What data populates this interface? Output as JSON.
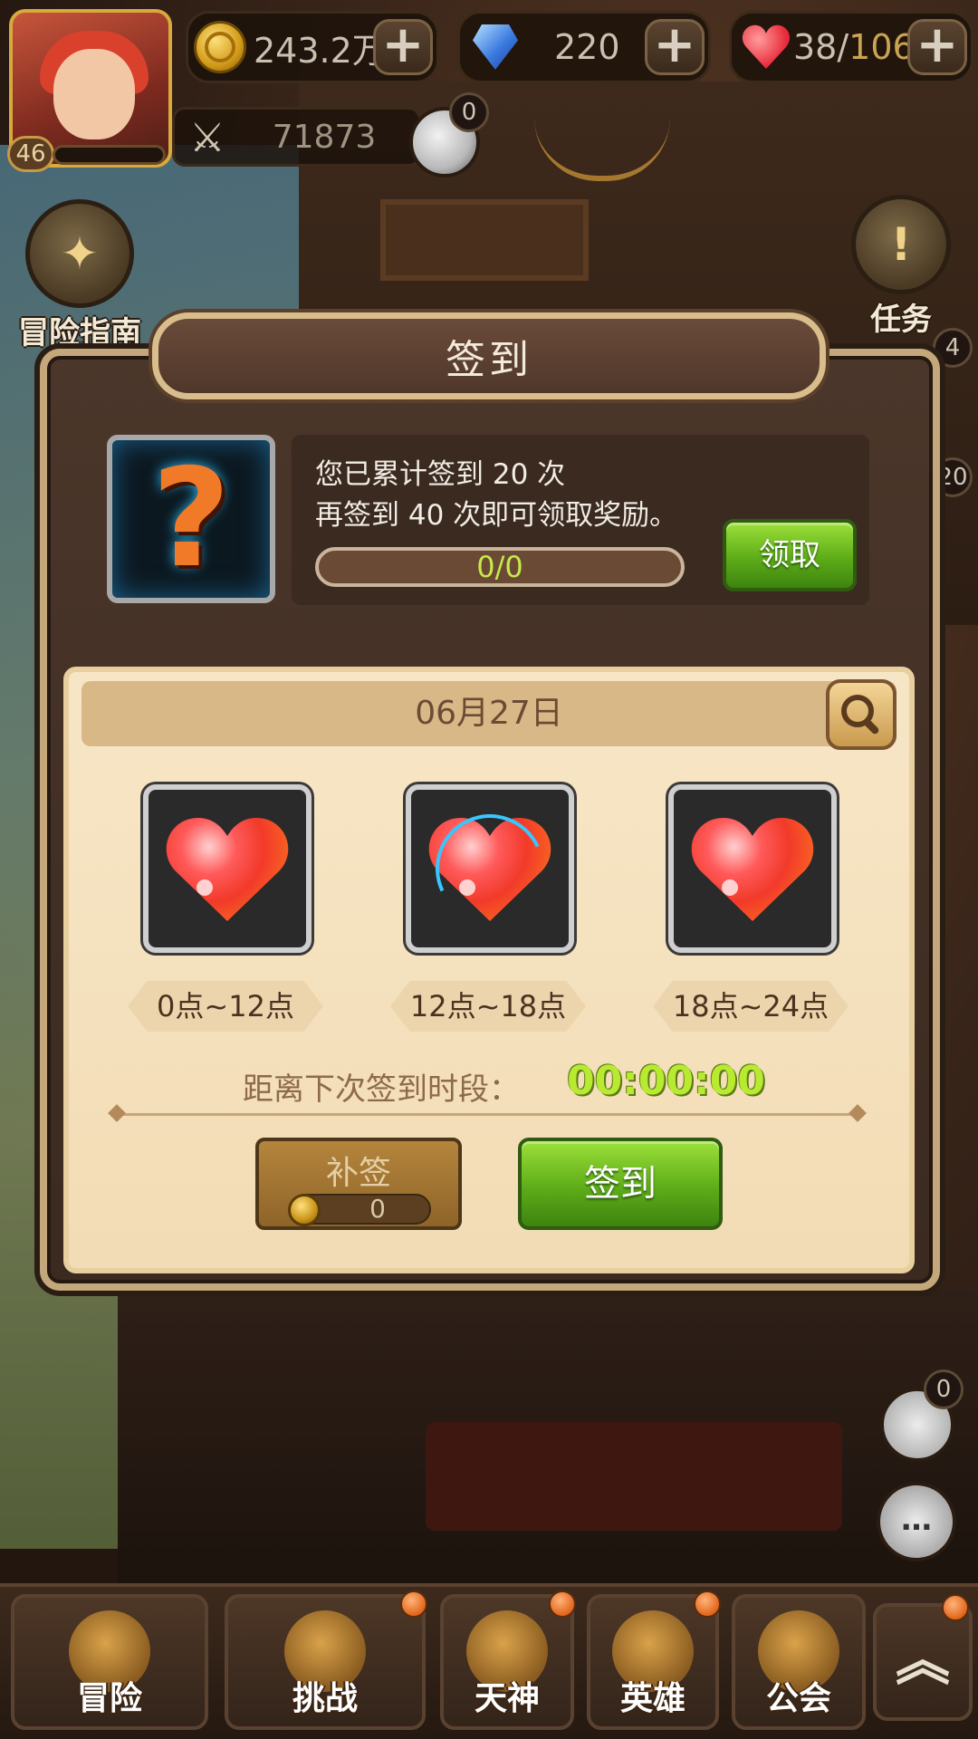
{
  "header": {
    "player_level": "46",
    "gold": "243.2万",
    "gems": "220",
    "stamina_current": "38",
    "stamina_separator": "/",
    "stamina_max": "106",
    "power": "71873",
    "chef_badge": "0"
  },
  "side": {
    "adventure_guide": "冒险指南",
    "tasks": "任务",
    "right_badge_1": "4",
    "right_badge_2": "20",
    "mail_badge": "0"
  },
  "dialog": {
    "title": "签到",
    "reward_line_1": "您已累计签到 20 次",
    "reward_line_2": "再签到 40 次即可领取奖励。",
    "progress_text": "0/0",
    "claim_label": "领取",
    "date": "06月27日",
    "slots": [
      {
        "label": "0点~12点",
        "active": false
      },
      {
        "label": "12点~18点",
        "active": true
      },
      {
        "label": "18点~24点",
        "active": false
      }
    ],
    "countdown_label": "距离下次签到时段：",
    "countdown_value": "00:00:00",
    "makeup_label": "补签",
    "makeup_cost": "0",
    "signin_label": "签到"
  },
  "nav": {
    "items": [
      {
        "label": "冒险"
      },
      {
        "label": "挑战"
      },
      {
        "label": "天神"
      },
      {
        "label": "英雄"
      },
      {
        "label": "公会"
      }
    ],
    "expand_icon": "double-chevron-up-icon"
  },
  "colors": {
    "accent_green": "#5dac18",
    "countdown": "#b8ea32",
    "stamina_max": "#c9a451",
    "parchment": "#f7e6c6"
  }
}
